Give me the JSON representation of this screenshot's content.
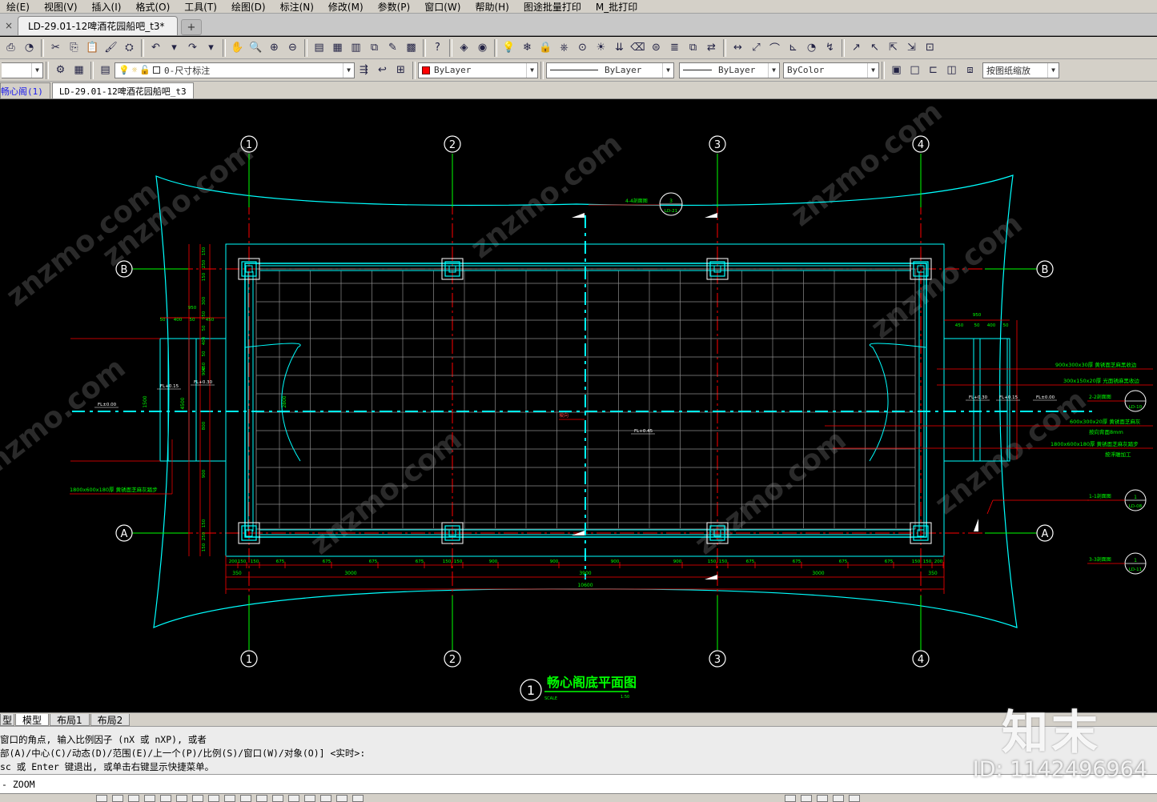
{
  "menu": [
    "绘(E)",
    "视图(V)",
    "插入(I)",
    "格式(O)",
    "工具(T)",
    "绘图(D)",
    "标注(N)",
    "修改(M)",
    "参数(P)",
    "窗口(W)",
    "帮助(H)",
    "图途批量打印",
    "M_批打印"
  ],
  "doc_tab": {
    "close": "×",
    "title": "LD-29.01-12啤酒花园船吧_t3*",
    "new_tab": "+"
  },
  "toolbar2": {
    "layer": "0-尺寸标注",
    "color": "ByLayer",
    "linetype": "ByLayer",
    "lineweight": "ByLayer",
    "plotstyle": "ByColor",
    "scale_hint": "按图纸缩放"
  },
  "file_tabs": [
    "畅心阁(1)",
    "LD-29.01-12啤酒花园船吧_t3"
  ],
  "layout_tabs": [
    "型",
    "模型",
    "布局1",
    "布局2"
  ],
  "command_history": [
    "窗口的角点, 输入比例因子 (nX 或 nXP), 或者",
    "部(A)/中心(C)/动态(D)/范围(E)/上一个(P)/比例(S)/窗口(W)/对象(O)] <实时>:",
    "sc 或 Enter 键退出, 或单击右键显示快捷菜单。"
  ],
  "command_line": "- ZOOM",
  "watermark": {
    "logo": "知末",
    "id": "ID: 1142496964",
    "site": "znzmo.com"
  },
  "drawing": {
    "title": "畅心阁底平面图",
    "title_number": "1",
    "scale": "1:50",
    "scale_label": "SCALE",
    "grid_cols": [
      "1",
      "2",
      "3",
      "4"
    ],
    "grid_rows": [
      "B",
      "A"
    ],
    "section_top": {
      "label": "4-4剖面图",
      "ref": "3",
      "sheet": "LD-21"
    },
    "section_right": [
      {
        "label": "2-2剖面图",
        "sheet": "LD-10"
      },
      {
        "label": "1-1剖面图",
        "ref": "1",
        "sheet": "LD-08"
      },
      {
        "label": "3-3剖面图",
        "ref": "1",
        "sheet": "LD-11"
      }
    ],
    "annotations_right": [
      "900x300x30厚 黄锈面芝麻黑收边",
      "300x150x20厚 光面锈麻黑收边",
      "600x300x20厚 黄锈面芝麻灰",
      "按向背面8mm",
      "1800x600x180厚 黄锈面芝麻灰踏步",
      "按浮雕加工"
    ],
    "annotation_left": "1800x600x180厚 黄锈面芝麻灰踏步",
    "levels": [
      "FL±0.00",
      "FL+0.15",
      "FL+0.30",
      "FL+0.45",
      "FL+0.30",
      "FL+0.15",
      "FL±0.00"
    ],
    "slope_label": "坡向",
    "bottom_dims_1": [
      "200",
      "150",
      "150",
      "675",
      "675",
      "675",
      "675",
      "150",
      "150",
      "900",
      "900",
      "900",
      "900",
      "150",
      "150",
      "675",
      "675",
      "675",
      "675",
      "150",
      "150",
      "200"
    ],
    "bottom_dims_2": [
      "350",
      "3000",
      "3900",
      "3000",
      "350"
    ],
    "bottom_dim_total": "10600",
    "left_dims": [
      "150",
      "250",
      "150",
      "300",
      "950",
      "50",
      "400",
      "50",
      "450",
      "900",
      "800",
      "900",
      "150",
      "250",
      "150"
    ],
    "left_vert": [
      "4500",
      "2800",
      "1500"
    ],
    "right_dims": [
      "950",
      "450",
      "50",
      "400",
      "50"
    ]
  },
  "colors": {
    "bg": "#000000",
    "cyan": "#00ffff",
    "green": "#00ff00",
    "red": "#ff0000",
    "white": "#ffffff",
    "grid": "#808080"
  }
}
